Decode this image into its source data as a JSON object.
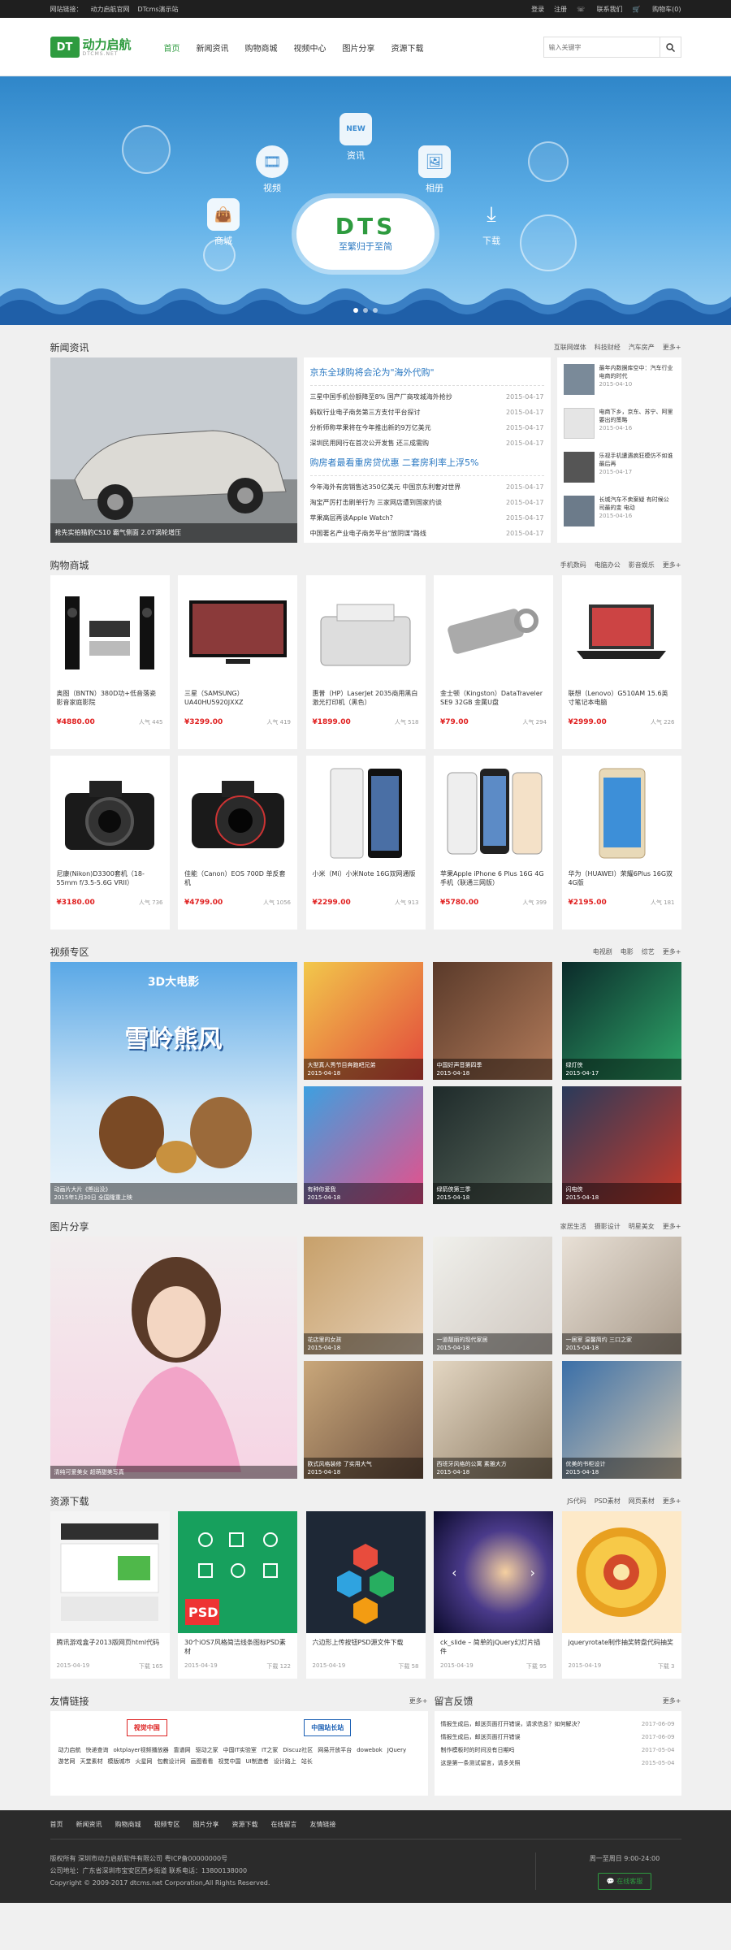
{
  "topbar": {
    "left_label": "网站链接：",
    "link1": "动力启航官网",
    "link2": "DTcms演示站",
    "login": "登录",
    "register": "注册",
    "contact": "联系我们",
    "cart": "购物车(0)"
  },
  "header": {
    "logo_mark": "DT",
    "logo_text": "动力启航",
    "logo_sub": "DTCMS.NET",
    "nav": [
      "首页",
      "新闻资讯",
      "购物商城",
      "视频中心",
      "图片分享",
      "资源下载"
    ],
    "search_placeholder": "输入关键字"
  },
  "banner": {
    "brand": "DTS",
    "slogan": "至繁归于至简",
    "icons": [
      "视频",
      "资讯",
      "相册",
      "商城",
      "下载"
    ],
    "new_tag": "NEW"
  },
  "news": {
    "title": "新闻资讯",
    "links": [
      "互联网媒体",
      "科技财经",
      "汽车房产",
      "更多+"
    ],
    "big_caption": "抢先实拍猎豹CS10 霸气侧面 2.0T涡轮增压",
    "head1": "京东全球购将会沦为\"海外代购\"",
    "list1": [
      [
        "三星中国手机份额降至8% 国产厂商攻城海外抢抄",
        "2015-04-17"
      ],
      [
        "蚂蚁行业电子商务第三方支付平台探讨",
        "2015-04-17"
      ],
      [
        "分析师称苹果将在今年推出新的9万亿美元",
        "2015-04-17"
      ],
      [
        "深圳民用网行在首次公开发售 还三成需购",
        "2015-04-17"
      ],
      [
        "深圳民用网行在首次公开发售 还三成需购",
        "2015-04-17"
      ]
    ],
    "head2": "购房者最看重房贷优惠 二套房利率上浮5%",
    "list2": [
      [
        "今年海外有房销售达350亿美元 中国京东利奢对世界",
        "2015-04-17"
      ],
      [
        "淘宝严厉打击刷单行为 三家网店遭到国家约谈",
        "2015-04-17"
      ],
      [
        "苹果高层再谈Apple Watch？",
        "2015-04-17"
      ],
      [
        "中国著名产业电子商务平台\"放阴谋\"路线",
        "2015-04-17"
      ]
    ],
    "side": [
      [
        "最年内数据库空中：汽车行业电商的时代",
        "2015-04-10"
      ],
      [
        "电商下乡，京东、苏宁、阿里要出的策略",
        "2015-04-16"
      ],
      [
        "乐视手机遭遇疯狂模仿不如谁最后再",
        "2015-04-17"
      ],
      [
        "长城汽车不卖案疑 有时候公司最的变 电动",
        "2015-04-16"
      ]
    ]
  },
  "shop": {
    "title": "购物商城",
    "links": [
      "手机数码",
      "电脑办公",
      "影音娱乐",
      "更多+"
    ],
    "products": [
      {
        "name": "奥图（BNTN）380D功+低音落瓷 影音家庭影院",
        "price": "¥4880.00",
        "hot": "人气 445"
      },
      {
        "name": "三星（SAMSUNG）UA40HU5920JXXZ",
        "price": "¥3299.00",
        "hot": "人气 419"
      },
      {
        "name": "惠普（HP）LaserJet 2035商用黑白激光打印机（黑色）",
        "price": "¥1899.00",
        "hot": "人气 518"
      },
      {
        "name": "金士顿（Kingston）DataTraveler SE9 32GB 金属U盘",
        "price": "¥79.00",
        "hot": "人气 294"
      },
      {
        "name": "联想（Lenovo）G510AM 15.6英寸笔记本电脑",
        "price": "¥2999.00",
        "hot": "人气 226"
      },
      {
        "name": "尼康(Nikon)D3300套机（18-55mm f/3.5-5.6G VRII）",
        "price": "¥3180.00",
        "hot": "人气 736"
      },
      {
        "name": "佳能（Canon）EOS 700D 单反套机",
        "price": "¥4799.00",
        "hot": "人气 1056"
      },
      {
        "name": "小米（Mi）小米Note 16G双网通版",
        "price": "¥2299.00",
        "hot": "人气 913"
      },
      {
        "name": "苹果Apple iPhone 6 Plus 16G 4G手机（联通三网版）",
        "price": "¥5780.00",
        "hot": "人气 399"
      },
      {
        "name": "华为（HUAWEI）荣耀6Plus 16G双4G版",
        "price": "¥2195.00",
        "hot": "人气 181"
      }
    ]
  },
  "video": {
    "title": "视频专区",
    "links": [
      "电视剧",
      "电影",
      "综艺",
      "更多+"
    ],
    "big_caption": "动画片大片《熊出没》",
    "big_date": "2015年1月30日 全国隆重上映",
    "poster_text": "3D大电影",
    "poster_title": "雪岭熊风",
    "items": [
      [
        "大型真人秀节目奔跑吧兄弟",
        "2015-04-18"
      ],
      [
        "中国好声音第四季",
        "2015-04-18"
      ],
      [
        "绿灯侠",
        "2015-04-17"
      ],
      [
        "有种你爱我",
        "2015-04-18"
      ],
      [
        "绿箭侠第三季",
        "2015-04-18"
      ],
      [
        "闪电侠",
        "2015-04-18"
      ]
    ]
  },
  "photo": {
    "title": "图片分享",
    "links": [
      "家居生活",
      "摄影设计",
      "明星美女",
      "更多+"
    ],
    "big_caption": "清纯可爱美女 超萌甜美写真",
    "items": [
      [
        "花店里的女孩",
        "2015-04-18"
      ],
      [
        "一道靓丽的现代家居",
        "2015-04-18"
      ],
      [
        "一居室 温馨简约 三口之家",
        "2015-04-18"
      ],
      [
        "欧式风格装修 了实用大气",
        "2015-04-18"
      ],
      [
        "西班牙风格的公寓 素雅大方",
        "2015-04-18"
      ],
      [
        "优美的书柜设计",
        "2015-04-18"
      ]
    ]
  },
  "download": {
    "title": "资源下载",
    "links": [
      "JS代码",
      "PSD素材",
      "网页素材",
      "更多+"
    ],
    "items": [
      {
        "name": "腾讯游戏盒子2013版网页html代码",
        "date": "2015-04-19",
        "count": "下载 165"
      },
      {
        "name": "30个iOS7风格简洁线条图标PSD素材",
        "date": "2015-04-19",
        "count": "下载 122"
      },
      {
        "name": "六边形上传按钮PSD源文件下载",
        "date": "2015-04-19",
        "count": "下载 58"
      },
      {
        "name": "ck_slide – 简单的jQuery幻灯片插件",
        "date": "2015-04-19",
        "count": "下载 95"
      },
      {
        "name": "jqueryrotate制作抽奖转盘代码抽奖",
        "date": "2015-04-19",
        "count": "下载 3"
      }
    ]
  },
  "friends": {
    "title": "友情链接",
    "more": "更多+",
    "logo1": "视觉中国",
    "logo2": "中国站长站",
    "text": [
      "动力启航",
      "快递查询",
      "oktplayer视频播放器",
      "靠谱网",
      "驱动之家",
      "中国IT实验室",
      "IT之家",
      "Discuz社区",
      "网易开放平台",
      "dowebok",
      "JQuery",
      "游艺网",
      "天堂素材",
      "模版城市",
      "火星网",
      "包教设计网",
      "画图看看",
      "视觉中国",
      "UI制造者",
      "设计路上",
      "站长"
    ]
  },
  "message": {
    "title": "留言反馈",
    "more": "更多+",
    "items": [
      [
        "情报生成后，邮送页面打开错误，请求信息？如何解决？",
        "2017-06-09"
      ],
      [
        "情报生成后，邮送页面打开错误",
        "2017-06-09"
      ],
      [
        "制作模板时的时间没有日期吗",
        "2017-05-04"
      ],
      [
        "这是第一条测试留言，请多关照",
        "2015-05-04"
      ]
    ]
  },
  "footer": {
    "nav": [
      "首页",
      "新闻资讯",
      "购物商城",
      "视频专区",
      "图片分享",
      "资源下载",
      "在线留言",
      "友情链接"
    ],
    "line1": "版权所有 深圳市动力启航软件有限公司 粤ICP备00000000号",
    "line2": "公司地址：广东省深圳市宝安区西乡街道 联系电话：13800138000",
    "line3": "Copyright © 2009-2017 dtcms.net Corporation,All Rights Reserved.",
    "hours": "周一至周日 9:00-24:00",
    "online": "在线客服"
  }
}
